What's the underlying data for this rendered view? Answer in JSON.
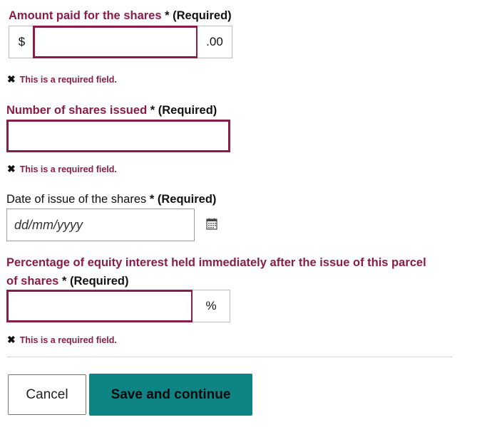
{
  "amount": {
    "label": "Amount paid for the shares",
    "star": "*",
    "required": "(Required)",
    "prefix": "$",
    "suffix": ".00",
    "value": "",
    "error": "This is a required field."
  },
  "shares": {
    "label": "Number of shares issued",
    "star": "*",
    "required": "(Required)",
    "value": "",
    "error": "This is a required field."
  },
  "date": {
    "label": "Date of issue of the shares",
    "star": "*",
    "required": "(Required)",
    "placeholder": "dd/mm/yyyy",
    "icon": "calendar-icon"
  },
  "percentage": {
    "label_line1": "Percentage of equity interest held immediately after the issue of this parcel",
    "label_line2": "of shares",
    "star": "*",
    "required": "(Required)",
    "suffix": "%",
    "value": "",
    "error": "This is a required field."
  },
  "error_icon": "cross-icon",
  "error_glyph": "✖",
  "buttons": {
    "cancel": "Cancel",
    "save": "Save and continue"
  },
  "colors": {
    "error": "#8a1c48",
    "primary": "#0f8484"
  }
}
